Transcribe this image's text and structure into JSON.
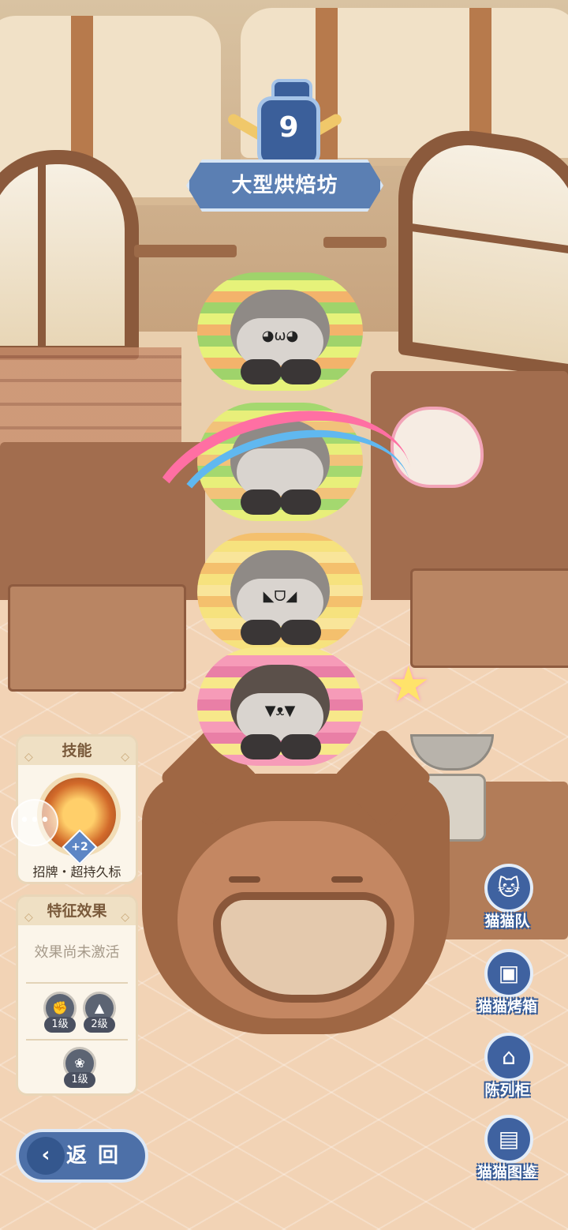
{
  "level": {
    "number": "9",
    "title": "大型烘焙坊"
  },
  "skill_panel": {
    "header": "技能",
    "skill_badge": "+2",
    "skill_name": "招牌・超持久标"
  },
  "trait_panel": {
    "header": "特征效果",
    "status": "效果尚未激活",
    "traits": [
      {
        "icon": "fist-icon",
        "level": "1级"
      },
      {
        "icon": "triangle-icon",
        "level": "2级"
      },
      {
        "icon": "paw-icon",
        "level": "1级"
      }
    ]
  },
  "back_button": {
    "label": "返回"
  },
  "side_menu": [
    {
      "icon": "cat-team-icon",
      "label": "猫猫队"
    },
    {
      "icon": "cat-oven-icon",
      "label": "猫猫烤箱"
    },
    {
      "icon": "display-cabinet-icon",
      "label": "陈列柜"
    },
    {
      "icon": "cat-encyclopedia-icon",
      "label": "猫猫图鉴"
    }
  ],
  "cats": [
    {
      "face": "◕ω◕",
      "colors": [
        "#e6f27a",
        "#9fd36b",
        "#f3b36b"
      ]
    },
    {
      "face": "",
      "colors": [
        "#e8ef7a",
        "#a4d86f",
        "#f2c27a"
      ]
    },
    {
      "face": "◣ᗜ◢",
      "colors": [
        "#f6e27e",
        "#f4c06d",
        "#f9e59a"
      ]
    },
    {
      "face": "▼ᴥ▼",
      "colors": [
        "#f69bb8",
        "#f7e88a",
        "#e97fa6"
      ]
    }
  ]
}
